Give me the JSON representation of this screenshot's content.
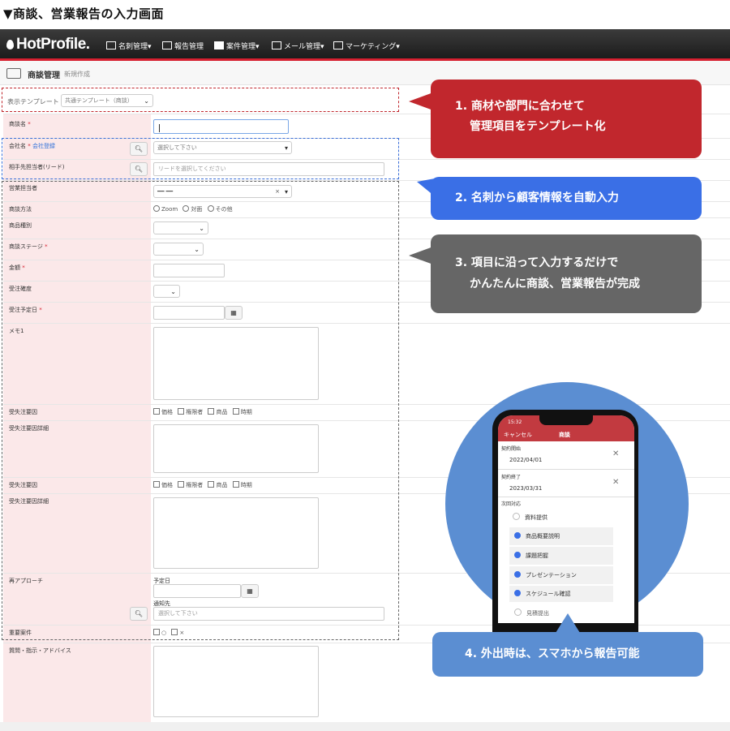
{
  "heading": "▼商談、営業報告の入力画面",
  "app": {
    "logo": "HotProfile.",
    "nav": [
      "名刺管理▾",
      "報告管理",
      "案件管理▾",
      "メール管理▾",
      "マーケティング▾"
    ]
  },
  "page": {
    "title": "商談管理",
    "mode": "新規作成"
  },
  "template": {
    "label": "表示テンプレート",
    "value": "共通テンプレート（商談）"
  },
  "form": {
    "deal_name": {
      "label": "商談名"
    },
    "company": {
      "label": "会社名",
      "link": "会社登録",
      "placeholder": "選択して下さい"
    },
    "contact": {
      "label": "相手先担当者(リード)",
      "placeholder": "リードを選択してください"
    },
    "sales_rep": {
      "label": "営業担当者",
      "value": "━━ ━━",
      "clear": "×"
    },
    "method": {
      "label": "商談方法",
      "options": [
        "Zoom",
        "対面",
        "その他"
      ]
    },
    "product_type": {
      "label": "商品種別"
    },
    "stage": {
      "label": "商談ステージ"
    },
    "amount": {
      "label": "金額"
    },
    "probability": {
      "label": "受注確度"
    },
    "planned_date": {
      "label": "受注予定日"
    },
    "memo": {
      "label": "メモ1"
    },
    "loss_reason": {
      "label": "受失注要因",
      "options": [
        "価格",
        "権限者",
        "商品",
        "時期"
      ]
    },
    "loss_detail": {
      "label": "受失注要因詳細"
    },
    "loss_reason2": {
      "label": "受失注要因",
      "options": [
        "価格",
        "権限者",
        "商品",
        "時期"
      ]
    },
    "loss_detail2": {
      "label": "受失注要因詳細"
    },
    "reapproach": {
      "label": "再アプローチ",
      "date_label": "予定日",
      "notify_label": "通知先",
      "notify_placeholder": "選択して下さい"
    },
    "important": {
      "label": "重要案件",
      "options": [
        "○",
        "×"
      ]
    },
    "advice": {
      "label": "質問・指示・アドバイス"
    }
  },
  "callouts": {
    "c1_line1": "1. 商材や部門に合わせて",
    "c1_line2": "管理項目をテンプレート化",
    "c2": "2. 名刺から顧客情報を自動入力",
    "c3_line1": "3. 項目に沿って入力するだけで",
    "c3_line2": "かんたんに商談、営業報告が完成",
    "c4": "4. 外出時は、スマホから報告可能"
  },
  "phone": {
    "time": "15:32",
    "cancel": "キャンセル",
    "title": "商談",
    "start_label": "契約開始",
    "start_value": "2022/04/01",
    "end_label": "契約終了",
    "end_value": "2023/03/31",
    "next_label": "次回対応",
    "items": [
      {
        "text": "資料提供",
        "checked": false
      },
      {
        "text": "商品概要説明",
        "checked": true
      },
      {
        "text": "課題把握",
        "checked": true
      },
      {
        "text": "プレゼンテーション",
        "checked": true
      },
      {
        "text": "スケジュール確認",
        "checked": true
      },
      {
        "text": "見積提出",
        "checked": false
      }
    ]
  },
  "colors": {
    "brand_red": "#c1272d",
    "blue": "#3a6fe6",
    "gray": "#666666",
    "light_blue": "#5b8ed2",
    "label_bg": "#fbe8e9"
  }
}
